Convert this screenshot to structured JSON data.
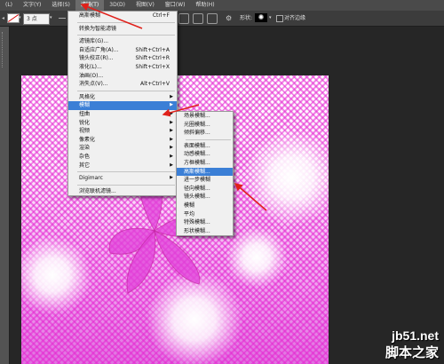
{
  "menubar": {
    "items": [
      "(L)",
      "文字(Y)",
      "选择(S)",
      "滤镜(T)",
      "3D(D)",
      "视图(V)",
      "窗口(W)",
      "帮助(H)"
    ],
    "active_index": 3
  },
  "optionsbar": {
    "stroke_width": "3 点",
    "shape_label": "形状:",
    "align_edges_label": "对齐边缘"
  },
  "filter_menu": {
    "section1": [
      {
        "label": "高斯模糊",
        "shortcut": "Ctrl+F"
      }
    ],
    "section2": [
      {
        "label": "转换为智能滤镜"
      }
    ],
    "section3": [
      {
        "label": "滤镜库(G)...",
        "shortcut": ""
      },
      {
        "label": "自适应广角(A)...",
        "shortcut": "Shift+Ctrl+A"
      },
      {
        "label": "镜头校正(R)...",
        "shortcut": "Shift+Ctrl+R"
      },
      {
        "label": "液化(L)...",
        "shortcut": "Shift+Ctrl+X"
      },
      {
        "label": "油画(O)...",
        "shortcut": ""
      },
      {
        "label": "消失点(V)...",
        "shortcut": "Alt+Ctrl+V"
      }
    ],
    "section4": [
      {
        "label": "风格化"
      },
      {
        "label": "模糊",
        "highlighted": true
      },
      {
        "label": "扭曲"
      },
      {
        "label": "锐化"
      },
      {
        "label": "视频"
      },
      {
        "label": "像素化"
      },
      {
        "label": "渲染"
      },
      {
        "label": "杂色"
      },
      {
        "label": "其它"
      }
    ],
    "section5": [
      {
        "label": "Digimarc"
      }
    ],
    "section6": [
      {
        "label": "浏览联机滤镜..."
      }
    ]
  },
  "blur_submenu": {
    "section1": [
      "场景模糊...",
      "光圈模糊...",
      "倾斜偏移..."
    ],
    "section2": [
      "表面模糊...",
      "动感模糊...",
      "方框模糊...",
      "高斯模糊...",
      "进一步模糊",
      "径向模糊...",
      "镜头模糊...",
      "模糊",
      "平均",
      "特殊模糊...",
      "形状模糊..."
    ],
    "highlighted": "高斯模糊..."
  },
  "colors": {
    "menu_highlight": "#3b7fd6",
    "annotation_arrow": "#e0201a",
    "canvas_pink": "#e070e0"
  },
  "watermark": {
    "site": "jb51.net",
    "name": "脚本之家"
  }
}
